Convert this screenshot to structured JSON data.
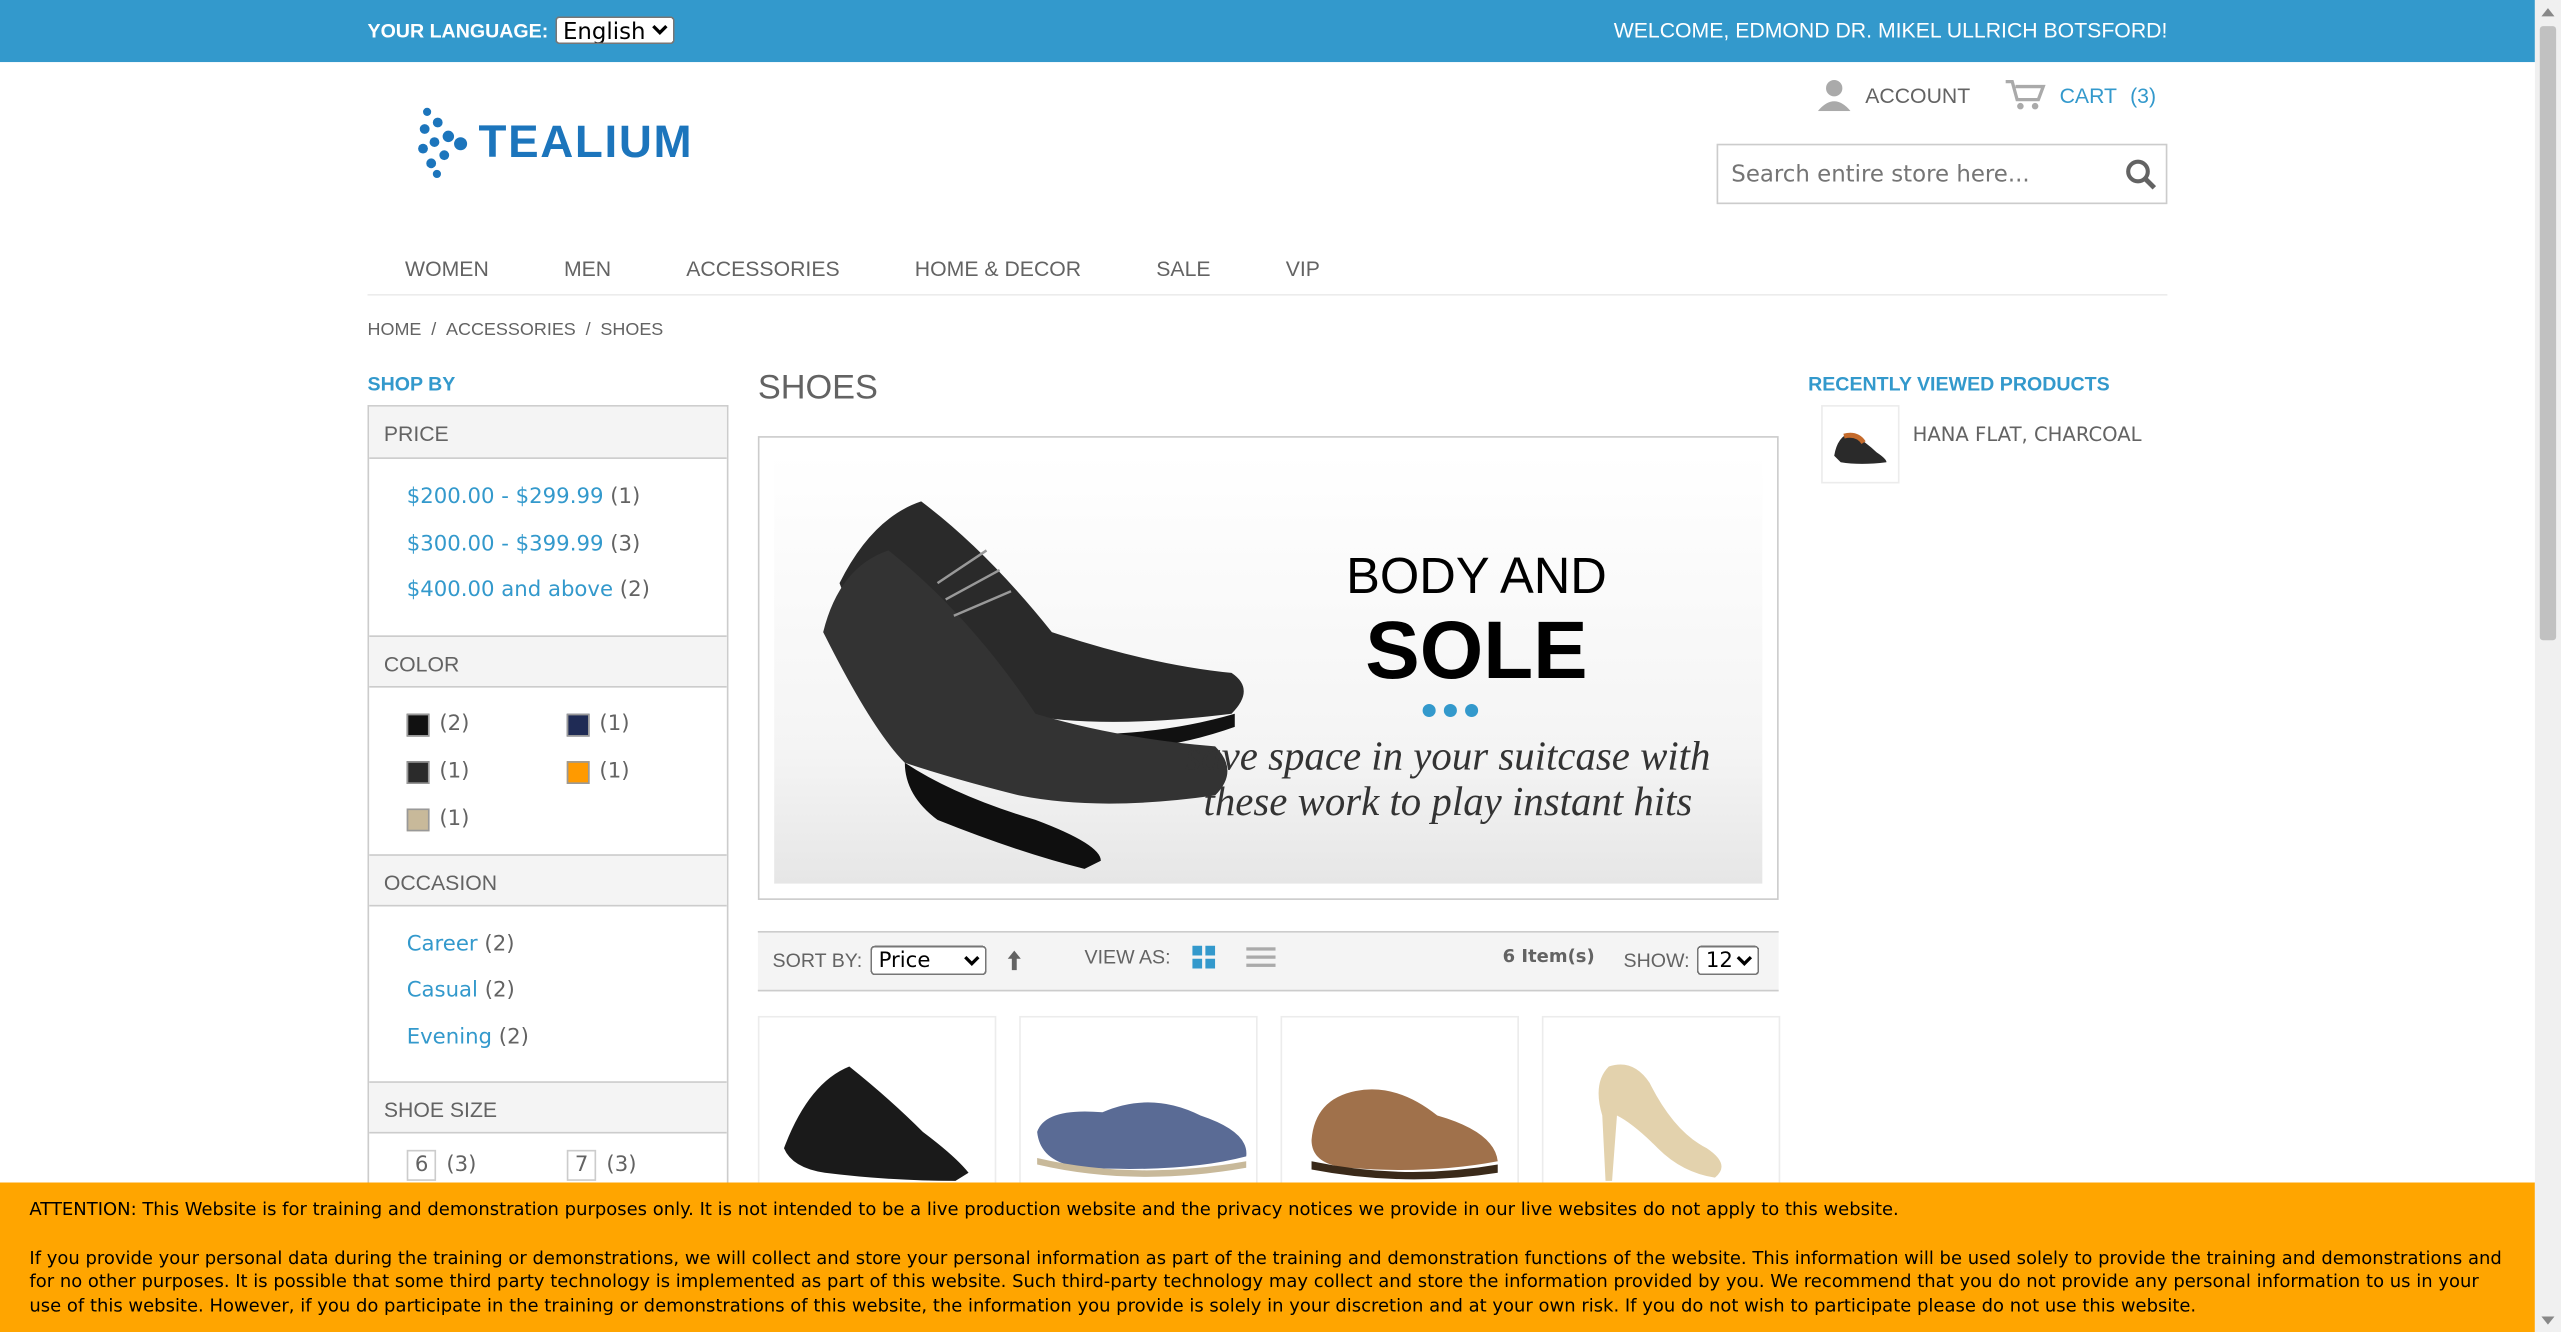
{
  "topbar": {
    "language_label": "YOUR LANGUAGE:",
    "language_value": "English",
    "welcome": "WELCOME, EDMOND DR. MIKEL ULLRICH BOTSFORD!"
  },
  "header": {
    "logo_text": "TEALIUM",
    "account_label": "ACCOUNT",
    "cart_label": "CART",
    "cart_count": "(3)",
    "search_placeholder": "Search entire store here..."
  },
  "nav": [
    "WOMEN",
    "MEN",
    "ACCESSORIES",
    "HOME & DECOR",
    "SALE",
    "VIP"
  ],
  "breadcrumb": [
    "HOME",
    "ACCESSORIES",
    "SHOES"
  ],
  "sidebar": {
    "title": "SHOP BY",
    "price": {
      "heading": "PRICE",
      "items": [
        {
          "label": "$200.00 - $299.99",
          "count": "(1)"
        },
        {
          "label": "$300.00 - $399.99",
          "count": "(3)"
        },
        {
          "label": "$400.00 and above",
          "count": "(2)"
        }
      ]
    },
    "color": {
      "heading": "COLOR",
      "items": [
        {
          "color": "#111111",
          "count": "(2)"
        },
        {
          "color": "#1f2b55",
          "count": "(1)"
        },
        {
          "color": "#2b2b2b",
          "count": "(1)"
        },
        {
          "color": "#ff9a00",
          "count": "(1)"
        },
        {
          "color": "#c8b99a",
          "count": "(1)"
        }
      ]
    },
    "occasion": {
      "heading": "OCCASION",
      "items": [
        {
          "label": "Career",
          "count": "(2)"
        },
        {
          "label": "Casual",
          "count": "(2)"
        },
        {
          "label": "Evening",
          "count": "(2)"
        }
      ]
    },
    "shoe_size": {
      "heading": "SHOE SIZE",
      "items": [
        {
          "label": "6",
          "count": "(3)"
        },
        {
          "label": "7",
          "count": "(3)"
        }
      ]
    }
  },
  "main": {
    "title": "SHOES",
    "banner": {
      "heading1": "BODY AND",
      "heading2": "SOLE",
      "subtitle": "save space in your suitcase with these work to play instant hits"
    },
    "toolbar": {
      "sort_label": "SORT BY:",
      "sort_value": "Price",
      "view_label": "VIEW AS:",
      "items_count": "6 Item(s)",
      "show_label": "SHOW:",
      "show_value": "12"
    }
  },
  "recently_viewed": {
    "title": "RECENTLY VIEWED PRODUCTS",
    "items": [
      {
        "name": "HANA FLAT, CHARCOAL"
      }
    ]
  },
  "notice": {
    "p1": "ATTENTION: This Website is for training and demonstration purposes only. It is not intended to be a live production website and the privacy notices we provide in our live websites do not apply to this website.",
    "p2": "If you provide your personal data during the training or demonstrations, we will collect and store your personal information as part of the training and demonstration functions of the website. This information will be used solely to provide the training and demonstrations and for no other purposes. It is possible that some third party technology is implemented as part of this website. Such third-party technology may collect and store the information provided by you. We recommend that you do not provide any personal information to us in your use of this website. However, if you do participate in the training or demonstrations of this website, the information you provide is solely in your discretion and at your own risk. If you do not wish to participate please do not use this website."
  }
}
